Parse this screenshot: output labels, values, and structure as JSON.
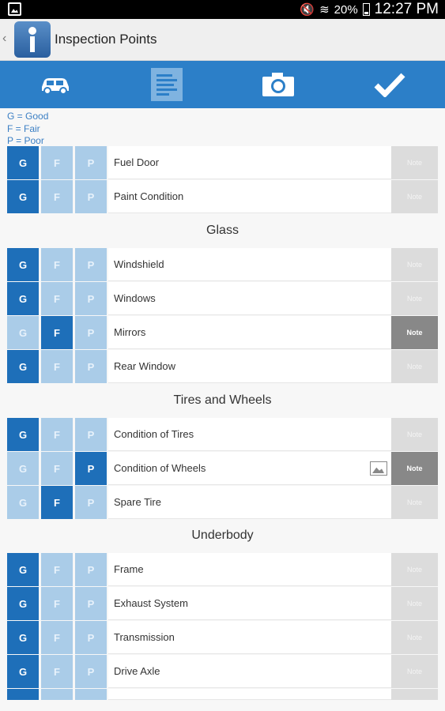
{
  "status": {
    "battery": "20%",
    "time": "12:27 PM"
  },
  "header": {
    "back": "‹",
    "title": "Inspection Points"
  },
  "tabs": [
    {
      "name": "vehicle",
      "icon": "car-icon"
    },
    {
      "name": "report",
      "icon": "document-icon"
    },
    {
      "name": "camera",
      "icon": "camera-icon"
    },
    {
      "name": "check",
      "icon": "checkmark-icon"
    }
  ],
  "legend": [
    "G = Good",
    "F = Fair",
    "P = Poor"
  ],
  "ratings": {
    "good": "G",
    "fair": "F",
    "poor": "P"
  },
  "note_label": "Note",
  "items": {
    "fuel_door": "Fuel Door",
    "paint_condition": "Paint Condition",
    "windshield": "Windshield",
    "windows": "Windows",
    "mirrors": "Mirrors",
    "rear_window": "Rear Window",
    "condition_tires": "Condition of Tires",
    "condition_wheels": "Condition of Wheels",
    "spare_tire": "Spare Tire",
    "frame": "Frame",
    "exhaust": "Exhaust System",
    "transmission": "Transmission",
    "drive_axle": "Drive Axle"
  },
  "sections": {
    "glass": "Glass",
    "tires": "Tires and Wheels",
    "underbody": "Underbody"
  },
  "colors": {
    "accent": "#2c7fc8",
    "selected": "#1e6fb9",
    "unselected": "#aacce8"
  }
}
